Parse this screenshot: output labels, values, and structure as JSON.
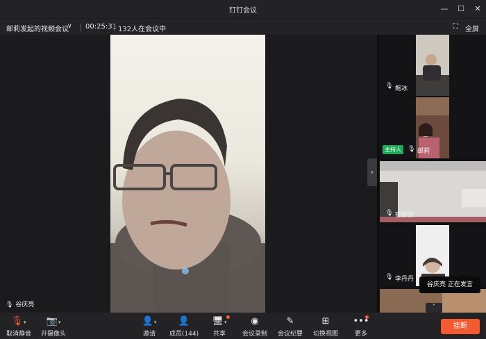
{
  "window": {
    "title": "钉钉会议"
  },
  "info": {
    "meeting_name": "邮莉发起的视频会议",
    "duration": "00:25:31",
    "attendance": "132人在会议中",
    "fullscreen_label": "全屏"
  },
  "main": {
    "speaker_name": "谷庆亮"
  },
  "participants": [
    {
      "name": "鲍冰"
    },
    {
      "name": "邮莉",
      "badge": "主持人"
    },
    {
      "name": "宿蔡蔡"
    },
    {
      "name": "李丹丹"
    }
  ],
  "toast": {
    "name": "谷庆亮",
    "status": "正在发言"
  },
  "toolbar": {
    "mute": "取消静音",
    "camera": "开摄像头",
    "invite": "邀请",
    "members": "成员(144)",
    "share": "共享",
    "record": "会议录制",
    "minutes": "会议纪要",
    "switch_view": "切换视图",
    "more": "更多",
    "hangup": "挂断"
  },
  "colors": {
    "accent_red": "#f25a32",
    "host_green": "#1faa5b",
    "mic_red": "#ff5a3c"
  }
}
